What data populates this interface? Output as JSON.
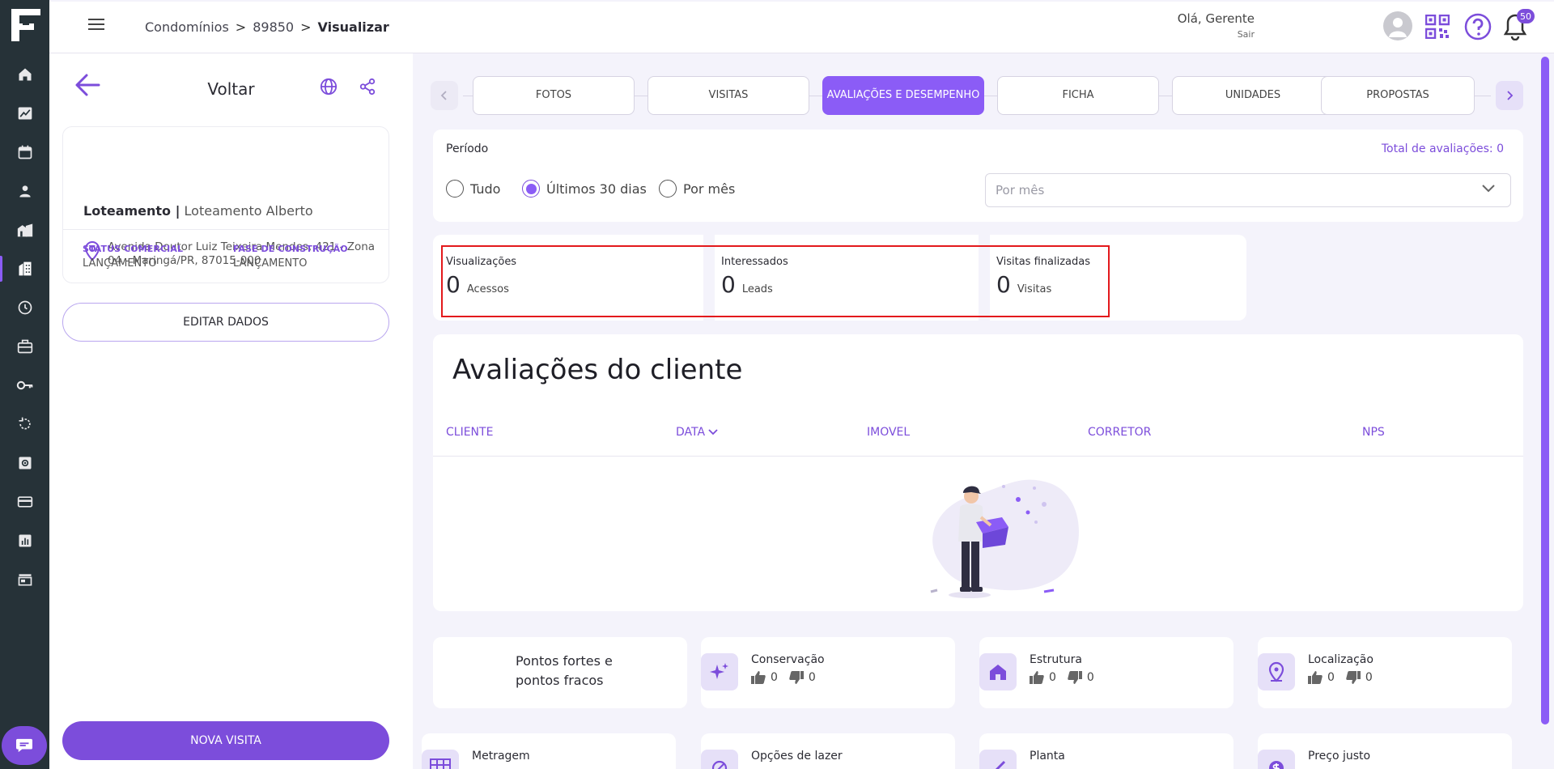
{
  "header": {
    "breadcrumb": [
      "Condomínios",
      "89850",
      "Visualizar"
    ],
    "breadcrumb_sep": ">",
    "greeting": "Olá, Gerente",
    "logout": "Sair",
    "notifications_count": "50"
  },
  "sidebar": {
    "icons": [
      "home-icon",
      "chart-line-icon",
      "calendar-icon",
      "person-icon",
      "buildings-icon",
      "condominium-icon",
      "clock-icon",
      "briefcase-icon",
      "key-icon",
      "history-icon",
      "settings-box-icon",
      "credit-card-icon",
      "bar-chart-icon",
      "store-icon"
    ],
    "active_index": 5
  },
  "property": {
    "back_label": "Voltar",
    "type": "Loteamento |",
    "name": "Loteamento Alberto",
    "address": "Avenida Doutor Luiz Teixeira Mendes, 421 - Zona 04 - Maringá/PR, 87015-000",
    "status_label": "STATUS COMERCIAL",
    "status_value": "LANÇAMENTO",
    "phase_label": "FASE DE CONSTRUÇÃO",
    "phase_value": "LANÇAMENTO",
    "edit_button": "EDITAR DADOS",
    "new_visit_button": "NOVA VISITA"
  },
  "tabs": [
    {
      "label": "FOTOS",
      "active": false
    },
    {
      "label": "VISITAS",
      "active": false
    },
    {
      "label": "AVALIAÇÕES E DESEMPENHO",
      "active": true
    },
    {
      "label": "FICHA",
      "active": false
    },
    {
      "label": "UNIDADES",
      "active": false
    },
    {
      "label": "PROPOSTAS",
      "active": false
    }
  ],
  "period": {
    "title": "Período",
    "total": "Total de avaliações: 0",
    "options": [
      "Tudo",
      "Últimos 30 dias",
      "Por mês"
    ],
    "selected_index": 1,
    "month_placeholder": "Por mês"
  },
  "metrics": [
    {
      "title": "Visualizações",
      "value": "0",
      "unit": "Acessos"
    },
    {
      "title": "Interessados",
      "value": "0",
      "unit": "Leads"
    },
    {
      "title": "Visitas finalizadas",
      "value": "0",
      "unit": "Visitas"
    }
  ],
  "evaluations": {
    "title": "Avaliações do cliente",
    "columns": [
      "CLIENTE",
      "DATA",
      "IMOVEL",
      "CORRETOR",
      "NPS"
    ]
  },
  "strengths": {
    "title_line1": "Pontos fortes e",
    "title_line2": "pontos fracos"
  },
  "categories": [
    {
      "name": "Conservação",
      "up": "0",
      "down": "0",
      "icon": "sparkle-icon"
    },
    {
      "name": "Estrutura",
      "up": "0",
      "down": "0",
      "icon": "house-icon"
    },
    {
      "name": "Localização",
      "up": "0",
      "down": "0",
      "icon": "location-pin-icon"
    },
    {
      "name": "Metragem",
      "icon": "grid-icon"
    },
    {
      "name": "Opções de lazer",
      "icon": "leisure-icon"
    },
    {
      "name": "Planta",
      "icon": "blueprint-icon"
    },
    {
      "name": "Preço justo",
      "icon": "price-icon"
    }
  ],
  "colors": {
    "accent": "#8b5cf6",
    "accent_dark": "#7c4ddb",
    "rail": "#263238",
    "highlight": "#e3191c"
  }
}
